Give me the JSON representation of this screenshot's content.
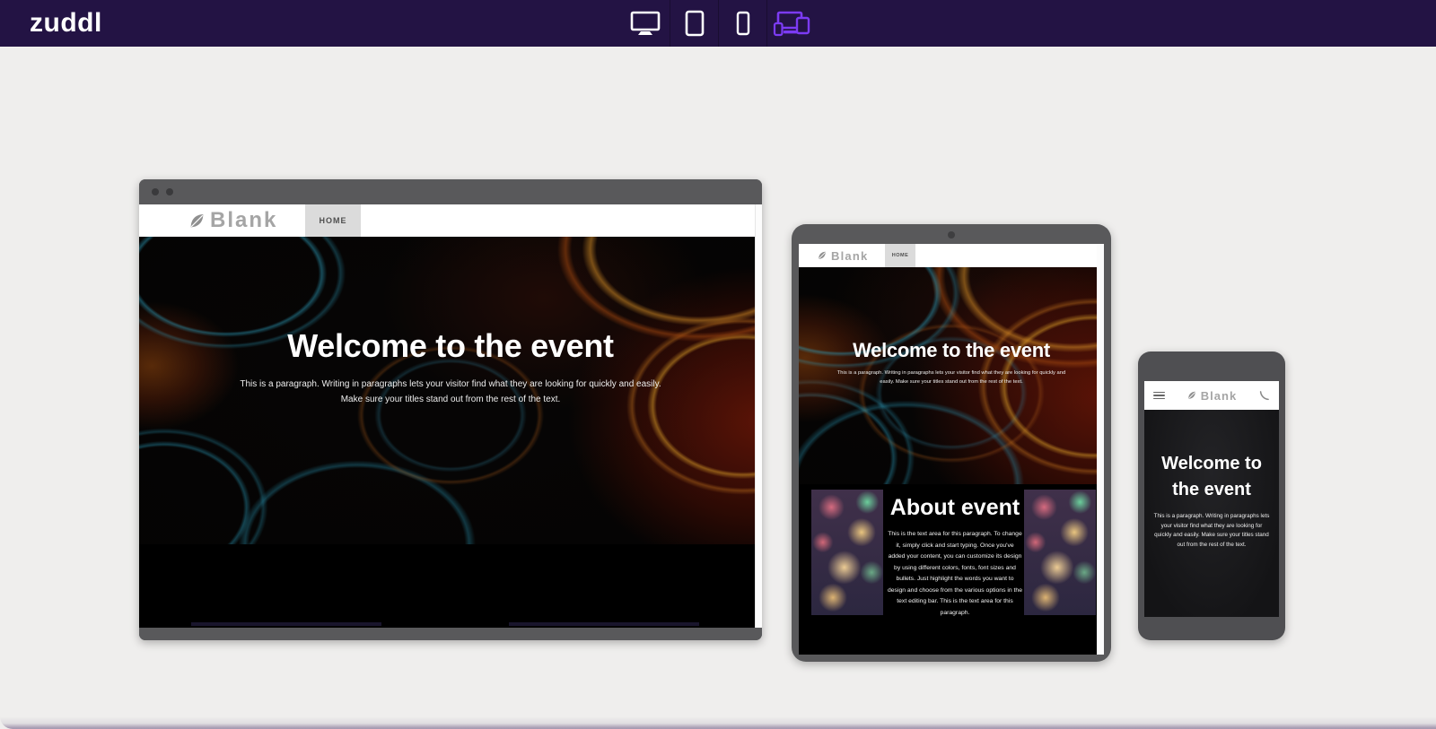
{
  "topbar": {
    "logo_text": "zuddl",
    "bg_color": "#231344",
    "accent_color": "#7c3bf4",
    "device_switcher": {
      "buttons": [
        {
          "device": "desktop",
          "icon": "monitor-icon",
          "active": false
        },
        {
          "device": "tablet",
          "icon": "tablet-icon",
          "active": false
        },
        {
          "device": "mobile",
          "icon": "smartphone-icon",
          "active": false
        },
        {
          "device": "all-devices",
          "icon": "responsive-devices-icon",
          "active": true
        }
      ]
    }
  },
  "previews": {
    "frame_color": "#59595b",
    "desktop": {
      "kind": "browser-window",
      "dots": 2,
      "has_scrollbar": true
    },
    "tablet": {
      "kind": "tablet",
      "camera_dot": true,
      "has_scrollbar": true
    },
    "mobile": {
      "kind": "smartphone",
      "menu_icon": "hamburger-icon",
      "call_icon": "phone-handset-icon"
    }
  },
  "site": {
    "brand": "Blank",
    "brand_icon": "leaf-icon",
    "nav": {
      "home": "HOME"
    },
    "hero": {
      "title": "Welcome to the event",
      "paragraph": "This is a paragraph. Writing in paragraphs lets your visitor find what they are looking for quickly and easily. Make sure your titles stand out from the rest of the text."
    },
    "about": {
      "title": "About event",
      "paragraph": "This is the text area for this paragraph. To change it, simply click and start typing. Once you've added your content, you can customize its design by using different colors, fonts, font sizes and bullets. Just highlight the words you want to design and choose from the various options in the text editing bar. This is the text area for this paragraph."
    }
  }
}
